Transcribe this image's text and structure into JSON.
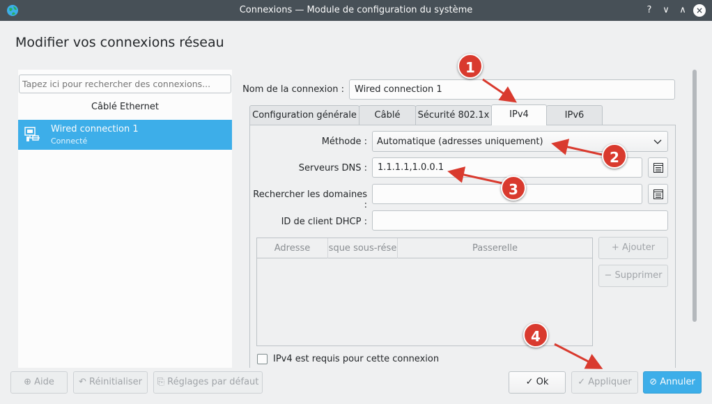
{
  "window": {
    "title": "Connexions — Module de configuration du système",
    "controls": [
      "?",
      "∨",
      "∧",
      "×"
    ]
  },
  "page_title": "Modifier vos connexions réseau",
  "sidebar": {
    "search_placeholder": "Tapez ici pour rechercher des connexions...",
    "group": "Câblé Ethernet",
    "connection": {
      "name": "Wired connection 1",
      "status": "Connecté"
    }
  },
  "form": {
    "name_label": "Nom de la connexion :",
    "name_value": "Wired connection 1",
    "tabs": [
      "Configuration générale",
      "Câblé",
      "Sécurité 802.1x",
      "IPv4",
      "IPv6"
    ],
    "active_tab": "IPv4",
    "method_label": "Méthode :",
    "method_value": "Automatique (adresses uniquement)",
    "dns_label": "Serveurs DNS :",
    "dns_value": "1.1.1.1,1.0.0.1",
    "domains_label": "Rechercher les domaines :",
    "domains_value": "",
    "dhcp_label": "ID de client DHCP :",
    "dhcp_value": "",
    "table_columns": [
      "Adresse",
      "sque sous-rése",
      "Passerelle"
    ],
    "add_button": "Ajouter",
    "remove_button": "Supprimer",
    "required_checkbox": "IPv4 est requis pour cette connexion"
  },
  "bottom": {
    "help": "Aide",
    "reset": "Réinitialiser",
    "defaults": "Réglages par défaut",
    "ok": "Ok",
    "apply": "Appliquer",
    "cancel": "Annuler"
  },
  "annotations": [
    "1",
    "2",
    "3",
    "4"
  ],
  "colors": {
    "accent": "#3daee9",
    "titlebar": "#475057",
    "annotation": "#d93a2e"
  }
}
